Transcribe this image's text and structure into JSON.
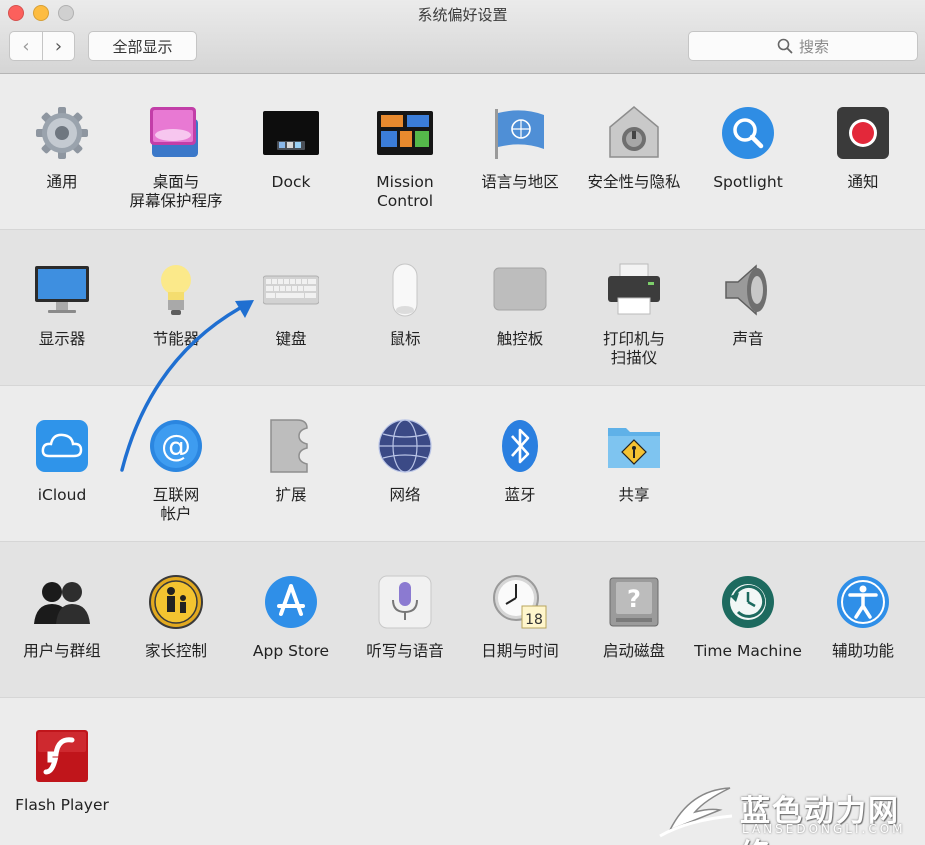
{
  "window": {
    "title": "系统偏好设置",
    "back_glyph": "‹",
    "forward_glyph": "›",
    "show_all_label": "全部显示",
    "search_placeholder": "搜索"
  },
  "sections": [
    {
      "items": [
        {
          "label": "通用",
          "icon": "gear-icon"
        },
        {
          "label": "桌面与\n屏幕保护程序",
          "icon": "desktop-screensaver-icon"
        },
        {
          "label": "Dock",
          "icon": "dock-icon"
        },
        {
          "label": "Mission\nControl",
          "icon": "mission-control-icon"
        },
        {
          "label": "语言与地区",
          "icon": "un-flag-icon"
        },
        {
          "label": "安全性与隐私",
          "icon": "security-house-icon"
        },
        {
          "label": "Spotlight",
          "icon": "spotlight-icon"
        },
        {
          "label": "通知",
          "icon": "notifications-icon"
        }
      ]
    },
    {
      "items": [
        {
          "label": "显示器",
          "icon": "display-icon"
        },
        {
          "label": "节能器",
          "icon": "lightbulb-icon"
        },
        {
          "label": "键盘",
          "icon": "keyboard-icon"
        },
        {
          "label": "鼠标",
          "icon": "mouse-icon"
        },
        {
          "label": "触控板",
          "icon": "trackpad-icon"
        },
        {
          "label": "打印机与\n扫描仪",
          "icon": "printer-icon"
        },
        {
          "label": "声音",
          "icon": "speaker-icon"
        }
      ]
    },
    {
      "items": [
        {
          "label": "iCloud",
          "icon": "icloud-icon"
        },
        {
          "label": "互联网\n帐户",
          "icon": "internet-accounts-icon"
        },
        {
          "label": "扩展",
          "icon": "extensions-icon"
        },
        {
          "label": "网络",
          "icon": "network-globe-icon"
        },
        {
          "label": "蓝牙",
          "icon": "bluetooth-icon"
        },
        {
          "label": "共享",
          "icon": "sharing-folder-icon"
        }
      ]
    },
    {
      "items": [
        {
          "label": "用户与群组",
          "icon": "users-groups-icon"
        },
        {
          "label": "家长控制",
          "icon": "parental-controls-icon"
        },
        {
          "label": "App Store",
          "icon": "app-store-icon"
        },
        {
          "label": "听写与语音",
          "icon": "microphone-icon"
        },
        {
          "label": "日期与时间",
          "icon": "clock-calendar-icon"
        },
        {
          "label": "启动磁盘",
          "icon": "startup-disk-icon"
        },
        {
          "label": "Time Machine",
          "icon": "time-machine-icon"
        },
        {
          "label": "辅助功能",
          "icon": "accessibility-icon"
        }
      ]
    },
    {
      "items": [
        {
          "label": "Flash Player",
          "icon": "flash-player-icon"
        }
      ]
    }
  ],
  "calendar_day": "18",
  "watermark": {
    "cn": "蓝色动力网络",
    "en": "LANSEDONGLI.COM"
  },
  "colors": {
    "annotation_arrow": "#1f6fd1",
    "close": "#fc605c",
    "minimize": "#fdbc40"
  }
}
